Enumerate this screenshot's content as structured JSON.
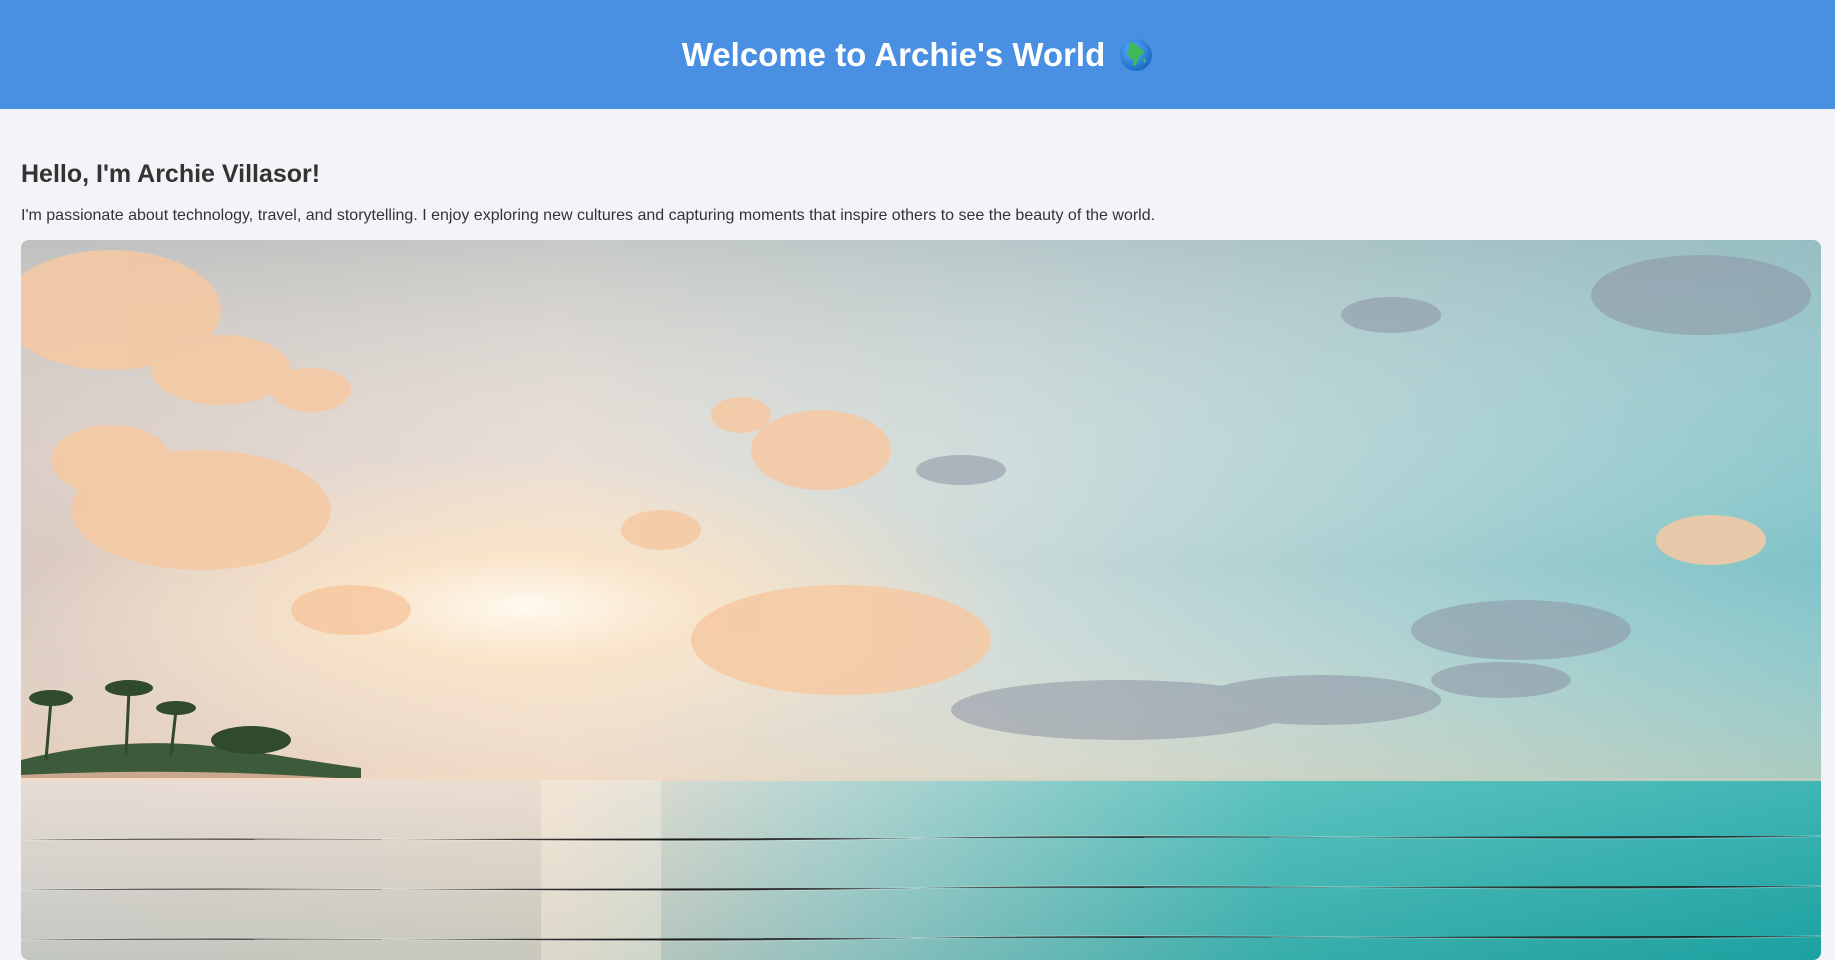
{
  "header": {
    "title": "Welcome to Archie's World",
    "icon": "globe-icon",
    "background": "#4a90e2"
  },
  "intro": {
    "heading": "Hello, I'm Archie Villasor!",
    "text": "I'm passionate about technology, travel, and storytelling. I enjoy exploring new cultures and capturing moments that inspire others to see the beauty of the world."
  },
  "hero_image": {
    "subject": "beach-sunset-photo"
  }
}
